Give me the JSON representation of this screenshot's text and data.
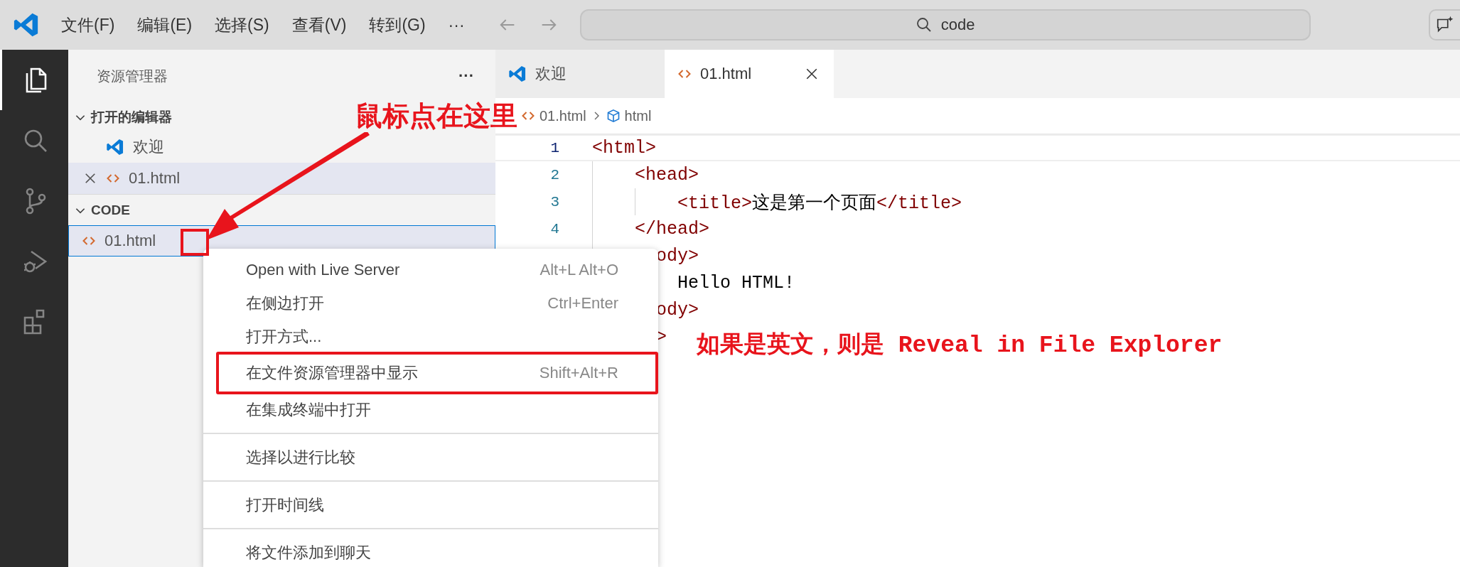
{
  "title_bar": {
    "menu": [
      "文件(F)",
      "编辑(E)",
      "选择(S)",
      "查看(V)",
      "转到(G)",
      "···"
    ],
    "search": {
      "value": "code"
    }
  },
  "activity_bar": [
    {
      "kind": "explorer",
      "selected": true
    },
    {
      "kind": "search",
      "selected": false
    },
    {
      "kind": "source-control",
      "selected": false
    },
    {
      "kind": "run-debug",
      "selected": false
    },
    {
      "kind": "extensions",
      "selected": false
    }
  ],
  "sidebar": {
    "title": "资源管理器",
    "more": "···",
    "sections": [
      {
        "title": "打开的编辑器",
        "expanded": true,
        "items": [
          {
            "label": "欢迎",
            "kind": "welcome",
            "selected": false,
            "focused": false,
            "closable": false
          },
          {
            "label": "01.html",
            "kind": "html",
            "selected": true,
            "focused": false,
            "closable": true
          }
        ]
      },
      {
        "title": "CODE",
        "expanded": true,
        "items": [
          {
            "label": "01.html",
            "kind": "html",
            "selected": true,
            "focused": true,
            "closable": false
          }
        ]
      }
    ]
  },
  "tabs": [
    {
      "label": "欢迎",
      "kind": "welcome",
      "selected": false,
      "closable": false
    },
    {
      "label": "01.html",
      "kind": "html",
      "selected": true,
      "closable": true
    }
  ],
  "breadcrumb": [
    {
      "label": "01.html",
      "kind": "html"
    },
    {
      "label": "html",
      "kind": "element"
    }
  ],
  "editor_lines": [
    {
      "number": "1",
      "current": true,
      "segments": [
        {
          "text": "<html>",
          "kind": "tag"
        }
      ]
    },
    {
      "number": "2",
      "current": false,
      "segments": [
        {
          "text": "    <head>",
          "kind": "tag"
        }
      ]
    },
    {
      "number": "3",
      "current": false,
      "segments": [
        {
          "text": "        <title>",
          "kind": "tag"
        },
        {
          "text": "这是第一个页面",
          "kind": "text"
        },
        {
          "text": "</title>",
          "kind": "tag"
        }
      ]
    },
    {
      "number": "4",
      "current": false,
      "segments": [
        {
          "text": "    </head>",
          "kind": "tag"
        }
      ]
    },
    {
      "current": false,
      "segments": [
        {
          "text": "      ody>",
          "kind": "tag"
        }
      ]
    },
    {
      "current": false,
      "segments": [
        {
          "text": "        Hello HTML!",
          "kind": "text"
        }
      ]
    },
    {
      "current": false,
      "segments": [
        {
          "text": "      ody>",
          "kind": "tag"
        }
      ]
    },
    {
      "current": false,
      "segments": [
        {
          "text": "      >",
          "kind": "tag"
        }
      ]
    }
  ],
  "context_menu": [
    {
      "label": "Open with Live Server",
      "shortcut": "Alt+L Alt+O",
      "separator_before": false
    },
    {
      "label": "在侧边打开",
      "shortcut": "Ctrl+Enter",
      "separator_before": false
    },
    {
      "label": "打开方式...",
      "separator_before": false
    },
    {
      "label": "在文件资源管理器中显示",
      "shortcut": "Shift+Alt+R",
      "separator_before": false,
      "annotated": true
    },
    {
      "label": "在集成终端中打开",
      "separator_before": false
    },
    {
      "label": "选择以进行比较",
      "separator_before": true
    },
    {
      "label": "打开时间线",
      "separator_before": true
    },
    {
      "label": "将文件添加到聊天",
      "separator_before": true
    }
  ],
  "annotations": [
    {
      "kind": "callout",
      "text": "鼠标点在这里"
    },
    {
      "kind": "note",
      "text": "如果是英文，则是 Reveal in File Explorer"
    }
  ]
}
